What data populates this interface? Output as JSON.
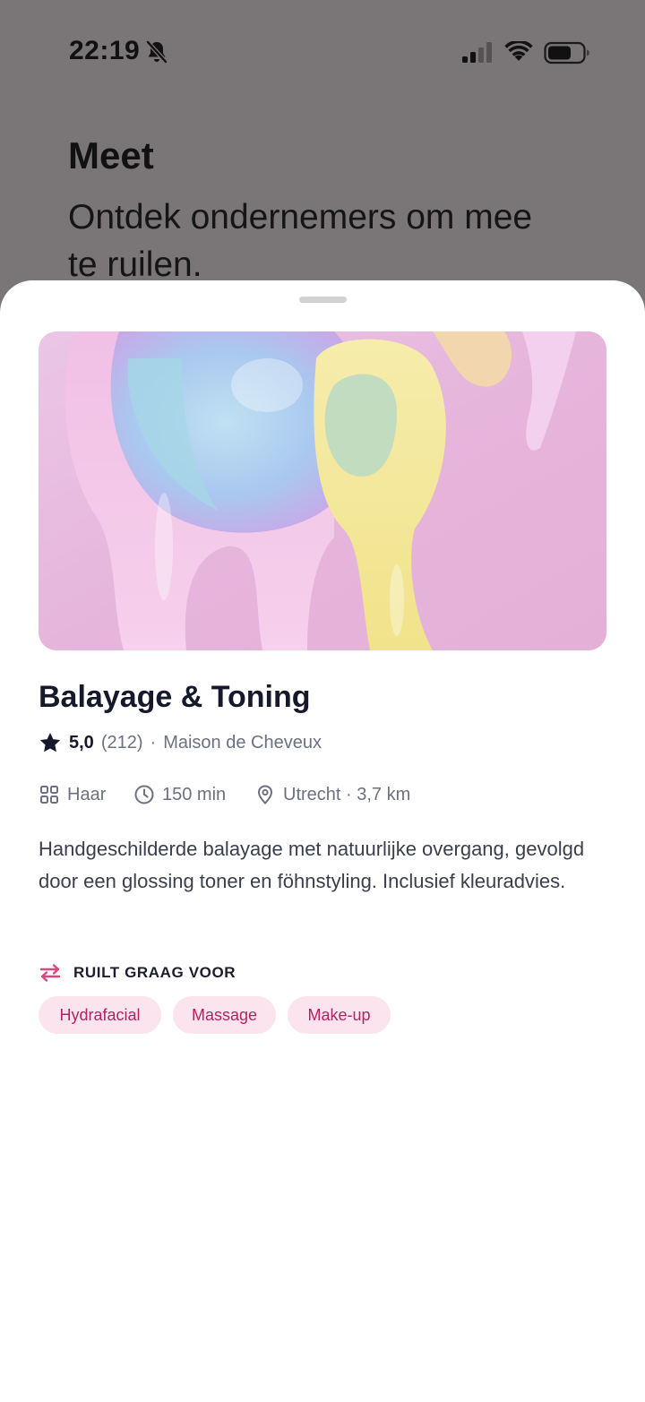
{
  "status_bar": {
    "time": "22:19",
    "icons": [
      "bell-slash-icon",
      "cellular-signal-icon",
      "wifi-icon",
      "battery-icon"
    ]
  },
  "background": {
    "title": "Meet",
    "subtitle": "Ontdek ondernemers om mee te ruilen."
  },
  "listing": {
    "title": "Balayage & Toning",
    "rating": "5,0",
    "review_count": "(212)",
    "separator": "·",
    "provider": "Maison de Cheveux",
    "category": "Haar",
    "duration": "150 min",
    "location": "Utrecht · 3,7 km",
    "description": "Handgeschilderde balayage met natuurlijke overgang, gevolgd door een glossing toner en föhnstyling. Inclusief kleuradvies.",
    "swap_heading": "RUILT GRAAG VOOR",
    "swap_tags": [
      "Hydrafacial",
      "Massage",
      "Make-up"
    ]
  },
  "colors": {
    "accent": "#e0457f",
    "tag_bg": "#fce4ef",
    "tag_text": "#b2245f",
    "backdrop": "#7a7577",
    "title_text": "#15192b"
  }
}
